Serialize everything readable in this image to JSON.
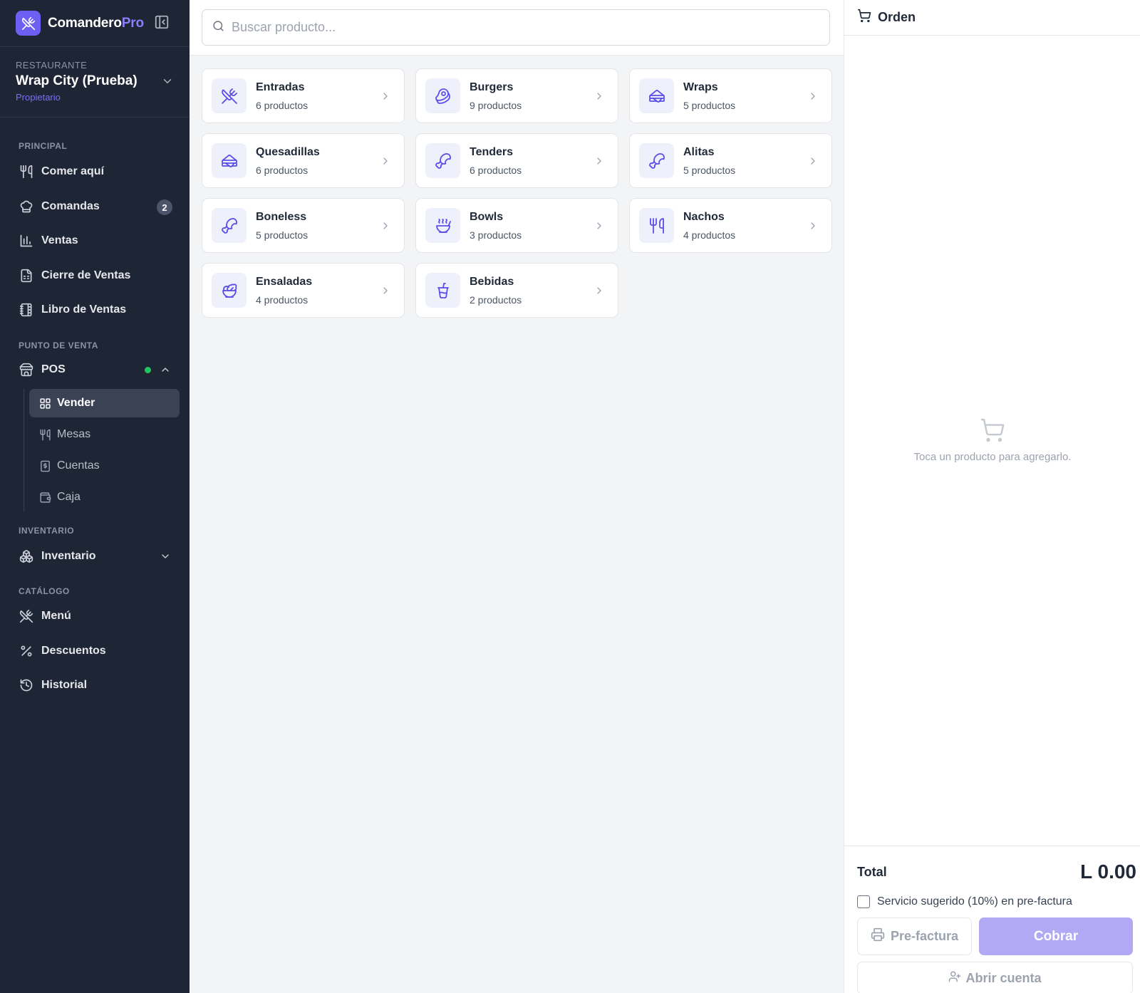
{
  "brand": {
    "name_main": "Comandero",
    "name_accent": "Pro"
  },
  "restaurant": {
    "caption": "RESTAURANTE",
    "name": "Wrap City (Prueba)",
    "role": "Propietario"
  },
  "sidebar": {
    "sections": {
      "principal": "PRINCIPAL",
      "pos": "PUNTO DE VENTA",
      "inventario": "INVENTARIO",
      "catalogo": "CATÁLOGO"
    },
    "items": {
      "comer": {
        "label": "Comer aquí"
      },
      "comandas": {
        "label": "Comandas",
        "badge": "2"
      },
      "ventas": {
        "label": "Ventas"
      },
      "cierre": {
        "label": "Cierre de Ventas"
      },
      "libro": {
        "label": "Libro de Ventas"
      },
      "pos": {
        "label": "POS"
      },
      "inventario": {
        "label": "Inventario"
      },
      "menu": {
        "label": "Menú"
      },
      "descuentos": {
        "label": "Descuentos"
      },
      "historial": {
        "label": "Historial"
      }
    },
    "pos_sub": {
      "vender": "Vender",
      "mesas": "Mesas",
      "cuentas": "Cuentas",
      "caja": "Caja"
    }
  },
  "search": {
    "placeholder": "Buscar producto...",
    "value": ""
  },
  "categories": [
    {
      "name": "Entradas",
      "count": "6 productos",
      "icon": "utensils-crossed-icon"
    },
    {
      "name": "Burgers",
      "count": "9 productos",
      "icon": "beef-icon"
    },
    {
      "name": "Wraps",
      "count": "5 productos",
      "icon": "sandwich-icon"
    },
    {
      "name": "Quesadillas",
      "count": "6 productos",
      "icon": "sandwich-icon"
    },
    {
      "name": "Tenders",
      "count": "6 productos",
      "icon": "drumstick-icon"
    },
    {
      "name": "Alitas",
      "count": "5 productos",
      "icon": "drumstick-icon"
    },
    {
      "name": "Boneless",
      "count": "5 productos",
      "icon": "drumstick-icon"
    },
    {
      "name": "Bowls",
      "count": "3 productos",
      "icon": "soup-icon"
    },
    {
      "name": "Nachos",
      "count": "4 productos",
      "icon": "utensils-icon"
    },
    {
      "name": "Ensaladas",
      "count": "4 productos",
      "icon": "salad-icon"
    },
    {
      "name": "Bebidas",
      "count": "2 productos",
      "icon": "cup-soda-icon"
    }
  ],
  "order": {
    "title": "Orden",
    "empty_text": "Toca un producto para agregarlo.",
    "total_label": "Total",
    "total_value": "L 0.00",
    "service_label": "Servicio sugerido (10%) en pre-factura",
    "service_checked": false,
    "prefactura_label": "Pre-factura",
    "cobrar_label": "Cobrar",
    "abrir_label": "Abrir cuenta"
  },
  "colors": {
    "sidebar": "#1e2535",
    "accent": "#6d5ff2",
    "accent_light": "#b2a9f4",
    "status_online": "#22c55e"
  }
}
